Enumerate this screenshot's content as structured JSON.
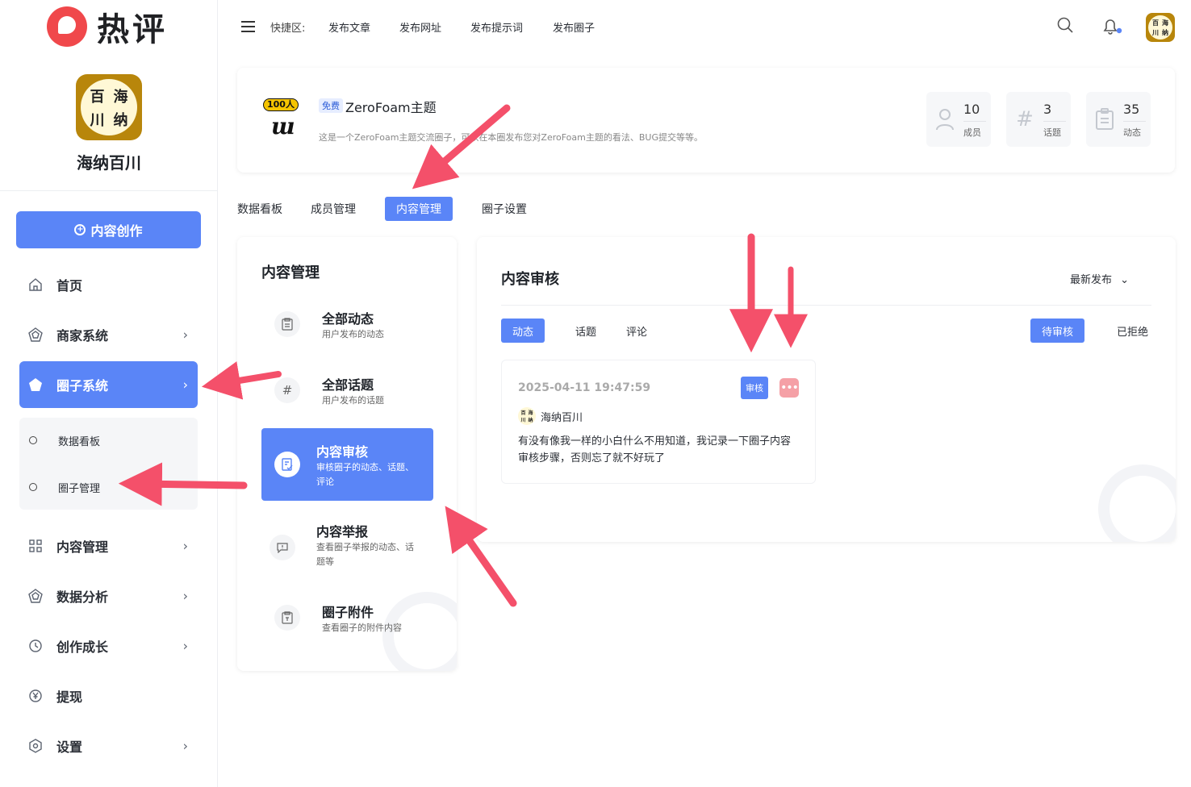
{
  "brand": {
    "name": "热评"
  },
  "user": {
    "name": "海纳百川",
    "avatar_chars": [
      "百",
      "海",
      "川",
      "纳"
    ]
  },
  "sidebar": {
    "create_label": "内容创作",
    "items": [
      {
        "label": "首页",
        "icon": "home-icon",
        "has_chevron": false
      },
      {
        "label": "商家系统",
        "icon": "shop-icon",
        "has_chevron": true
      },
      {
        "label": "圈子系统",
        "icon": "circle-system-icon",
        "has_chevron": true,
        "active": true
      },
      {
        "label": "内容管理",
        "icon": "grid-icon",
        "has_chevron": true
      },
      {
        "label": "数据分析",
        "icon": "analytics-icon",
        "has_chevron": true
      },
      {
        "label": "创作成长",
        "icon": "growth-icon",
        "has_chevron": true
      },
      {
        "label": "提现",
        "icon": "yen-icon",
        "has_chevron": false
      },
      {
        "label": "设置",
        "icon": "settings-icon",
        "has_chevron": true
      }
    ],
    "submenu": [
      {
        "label": "数据看板"
      },
      {
        "label": "圈子管理"
      }
    ]
  },
  "topbar": {
    "quick_label": "快捷区:",
    "links": [
      "发布文章",
      "发布网址",
      "发布提示词",
      "发布圈子"
    ],
    "icons": [
      "search-icon",
      "bell-icon"
    ],
    "notification_dot_color": "#5a85f7"
  },
  "circle": {
    "badge": "100人",
    "free_tag": "免费",
    "name": "ZeroFoam主题",
    "description": "这是一个ZeroFoam主题交流圈子，可以在本圈发布您对ZeroFoam主题的看法、BUG提交等等。",
    "stats": [
      {
        "value": "10",
        "label": "成员",
        "icon": "user-icon"
      },
      {
        "value": "3",
        "label": "话题",
        "icon": "hash-icon"
      },
      {
        "value": "35",
        "label": "动态",
        "icon": "clipboard-icon"
      }
    ]
  },
  "tabs": [
    {
      "label": "数据看板"
    },
    {
      "label": "成员管理"
    },
    {
      "label": "内容管理",
      "active": true
    },
    {
      "label": "圈子设置"
    }
  ],
  "content_mgmt": {
    "title": "内容管理",
    "items": [
      {
        "title": "全部动态",
        "subtitle": "用户发布的动态",
        "icon": "clipboard-icon"
      },
      {
        "title": "全部话题",
        "subtitle": "用户发布的话题",
        "icon": "hash-icon"
      },
      {
        "title": "内容审核",
        "subtitle": "审核圈子的动态、话题、评论",
        "icon": "audit-icon",
        "active": true
      },
      {
        "title": "内容举报",
        "subtitle": "查看圈子举报的动态、话题等",
        "icon": "report-icon"
      },
      {
        "title": "圈子附件",
        "subtitle": "查看圈子的附件内容",
        "icon": "attachment-icon"
      }
    ]
  },
  "review": {
    "title": "内容审核",
    "sort_label": "最新发布",
    "type_tabs": [
      {
        "label": "动态",
        "active": true
      },
      {
        "label": "话题"
      },
      {
        "label": "评论"
      }
    ],
    "status_tabs": [
      {
        "label": "待审核",
        "active": true
      },
      {
        "label": "已拒绝"
      }
    ],
    "post": {
      "time": "2025-04-11 19:47:59",
      "audit_label": "审核",
      "more_label": "•••",
      "author": "海纳百川",
      "text": "有没有像我一样的小白什么不用知道，我记录一下圈子内容审核步骤，否则忘了就不好玩了"
    }
  },
  "colors": {
    "accent": "#5a85f7",
    "brand_red": "#f0484b",
    "arrow": "#f4506a",
    "more_button": "#f5a0a6"
  }
}
